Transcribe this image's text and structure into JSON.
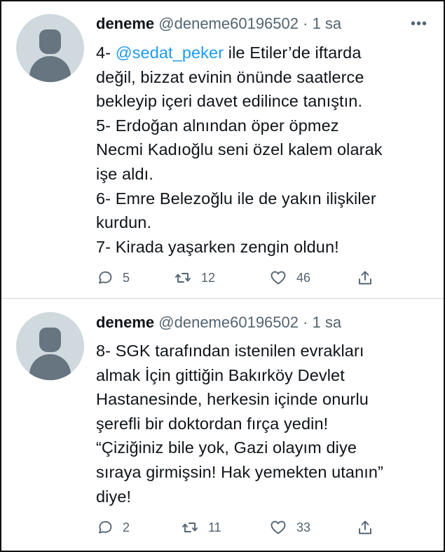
{
  "tweets": [
    {
      "name": "deneme",
      "handle": "@deneme60196502",
      "sep": "·",
      "time": "1 sa",
      "lines": [
        {
          "pre": "4- ",
          "mention": "@sedat_peker",
          "post": " ile Etiler’de iftarda"
        },
        {
          "text": "değil, bizzat evinin önünde saatlerce"
        },
        {
          "text": "bekleyip içeri davet edilince tanıştın."
        },
        {
          "text": "5- Erdoğan alnından öper öpmez"
        },
        {
          "text": "Necmi Kadıoğlu seni özel kalem olarak"
        },
        {
          "text": "işe aldı."
        },
        {
          "text": "6- Emre Belezoğlu ile de yakın ilişkiler"
        },
        {
          "text": "kurdun."
        },
        {
          "text": "7- Kirada yaşarken zengin oldun!"
        }
      ],
      "replies": "5",
      "retweets": "12",
      "likes": "46"
    },
    {
      "name": "deneme",
      "handle": "@deneme60196502",
      "sep": "·",
      "time": "1 sa",
      "lines": [
        {
          "text": "8- SGK tarafından istenilen evrakları"
        },
        {
          "text": "almak İçin gittiğin Bakırköy Devlet"
        },
        {
          "text": "Hastanesinde, herkesin içinde onurlu"
        },
        {
          "text": "şerefli bir doktordan fırça yedin!"
        },
        {
          "text": "“Çiziğiniz bile yok, Gazi olayım diye"
        },
        {
          "text": "sıraya girmişsin! Hak yemekten utanın”"
        },
        {
          "text": "diye!"
        }
      ],
      "replies": "2",
      "retweets": "11",
      "likes": "33"
    }
  ],
  "icons": {
    "more": "more-icon",
    "reply": "reply-icon",
    "retweet": "retweet-icon",
    "like": "like-icon",
    "share": "share-icon"
  },
  "colors": {
    "mention": "#1d9bf0",
    "secondary": "#536471",
    "avatar_bg": "#cfd9de",
    "avatar_fg": "#66757f"
  }
}
